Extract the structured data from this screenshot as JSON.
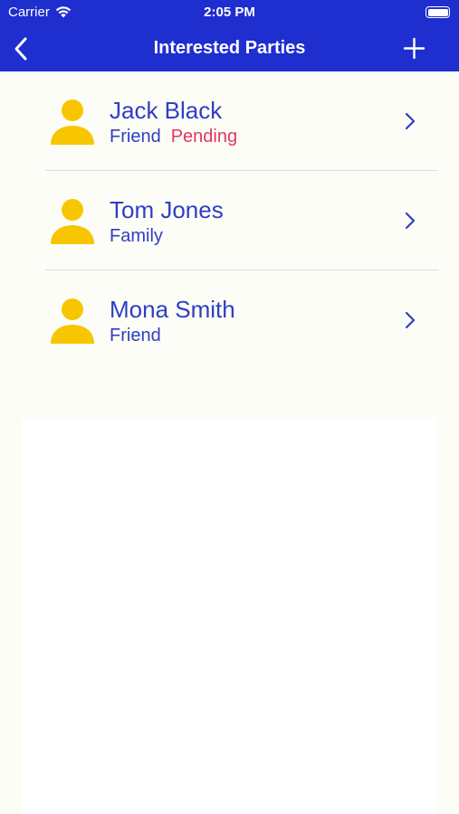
{
  "status_bar": {
    "carrier": "Carrier",
    "time": "2:05 PM"
  },
  "nav": {
    "title": "Interested Parties",
    "back_icon": "chevron-left-icon",
    "add_icon": "plus-icon"
  },
  "parties": [
    {
      "name": "Jack Black",
      "relation": "Friend",
      "status": "Pending"
    },
    {
      "name": "Tom Jones",
      "relation": "Family",
      "status": ""
    },
    {
      "name": "Mona Smith",
      "relation": "Friend",
      "status": ""
    }
  ],
  "colors": {
    "nav_background": "#1f2ecf",
    "accent_text": "#2d3fc4",
    "pending": "#e3355d",
    "avatar": "#f7c600",
    "background": "#fdfdf7"
  }
}
